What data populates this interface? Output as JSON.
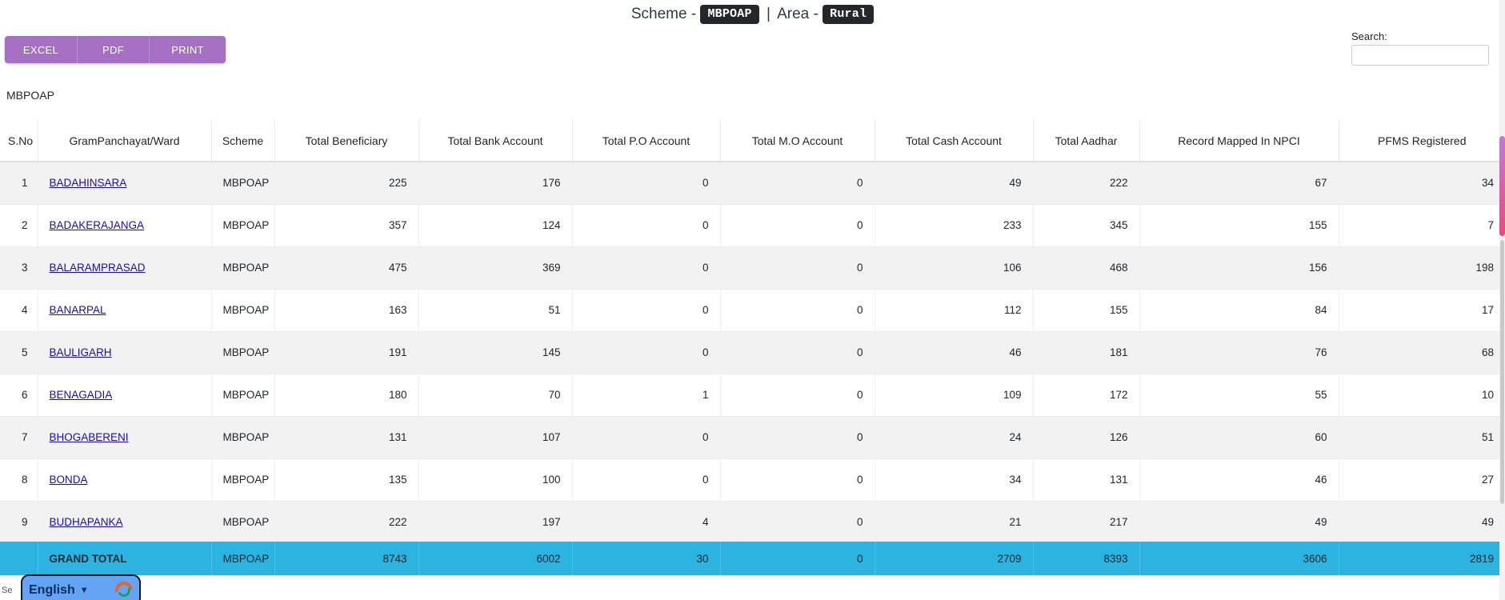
{
  "header": {
    "scheme_label": "Scheme -",
    "scheme_value": "MBPOAP",
    "divider": "|",
    "area_label": "Area -",
    "area_value": "Rural"
  },
  "toolbar": {
    "excel_label": "EXCEL",
    "pdf_label": "PDF",
    "print_label": "PRINT",
    "accent_color": "#a56fc4"
  },
  "search": {
    "label": "Search:",
    "value": "",
    "placeholder": ""
  },
  "table_caption": "MBPOAP",
  "table": {
    "columns": [
      "S.No",
      "GramPanchayat/Ward",
      "Scheme",
      "Total Beneficiary",
      "Total Bank Account",
      "Total P.O Account",
      "Total M.O Account",
      "Total Cash Account",
      "Total Aadhar",
      "Record Mapped In NPCI",
      "PFMS Registered"
    ],
    "rows": [
      {
        "sno": "1",
        "gp": "BADAHINSARA",
        "scheme": "MBPOAP",
        "beneficiary": "225",
        "bank": "176",
        "po": "0",
        "mo": "0",
        "cash": "49",
        "aadhar": "222",
        "npci": "67",
        "pfms": "34"
      },
      {
        "sno": "2",
        "gp": "BADAKERAJANGA",
        "scheme": "MBPOAP",
        "beneficiary": "357",
        "bank": "124",
        "po": "0",
        "mo": "0",
        "cash": "233",
        "aadhar": "345",
        "npci": "155",
        "pfms": "7"
      },
      {
        "sno": "3",
        "gp": "BALARAMPRASAD",
        "scheme": "MBPOAP",
        "beneficiary": "475",
        "bank": "369",
        "po": "0",
        "mo": "0",
        "cash": "106",
        "aadhar": "468",
        "npci": "156",
        "pfms": "198"
      },
      {
        "sno": "4",
        "gp": "BANARPAL",
        "scheme": "MBPOAP",
        "beneficiary": "163",
        "bank": "51",
        "po": "0",
        "mo": "0",
        "cash": "112",
        "aadhar": "155",
        "npci": "84",
        "pfms": "17"
      },
      {
        "sno": "5",
        "gp": "BAULIGARH",
        "scheme": "MBPOAP",
        "beneficiary": "191",
        "bank": "145",
        "po": "0",
        "mo": "0",
        "cash": "46",
        "aadhar": "181",
        "npci": "76",
        "pfms": "68"
      },
      {
        "sno": "6",
        "gp": "BENAGADIA",
        "scheme": "MBPOAP",
        "beneficiary": "180",
        "bank": "70",
        "po": "1",
        "mo": "0",
        "cash": "109",
        "aadhar": "172",
        "npci": "55",
        "pfms": "10"
      },
      {
        "sno": "7",
        "gp": "BHOGABERENI",
        "scheme": "MBPOAP",
        "beneficiary": "131",
        "bank": "107",
        "po": "0",
        "mo": "0",
        "cash": "24",
        "aadhar": "126",
        "npci": "60",
        "pfms": "51"
      },
      {
        "sno": "8",
        "gp": "BONDA",
        "scheme": "MBPOAP",
        "beneficiary": "135",
        "bank": "100",
        "po": "0",
        "mo": "0",
        "cash": "34",
        "aadhar": "131",
        "npci": "46",
        "pfms": "27"
      },
      {
        "sno": "9",
        "gp": "BUDHAPANKA",
        "scheme": "MBPOAP",
        "beneficiary": "222",
        "bank": "197",
        "po": "4",
        "mo": "0",
        "cash": "21",
        "aadhar": "217",
        "npci": "49",
        "pfms": "49"
      }
    ],
    "grand_total": {
      "label": "GRAND TOTAL",
      "scheme": "MBPOAP",
      "beneficiary": "8743",
      "bank": "6002",
      "po": "30",
      "mo": "0",
      "cash": "2709",
      "aadhar": "8393",
      "npci": "3606",
      "pfms": "2819",
      "row_color": "#2cb3e2"
    }
  },
  "language_widget": {
    "prefix": "Se",
    "label": "English",
    "caret": "▼"
  }
}
